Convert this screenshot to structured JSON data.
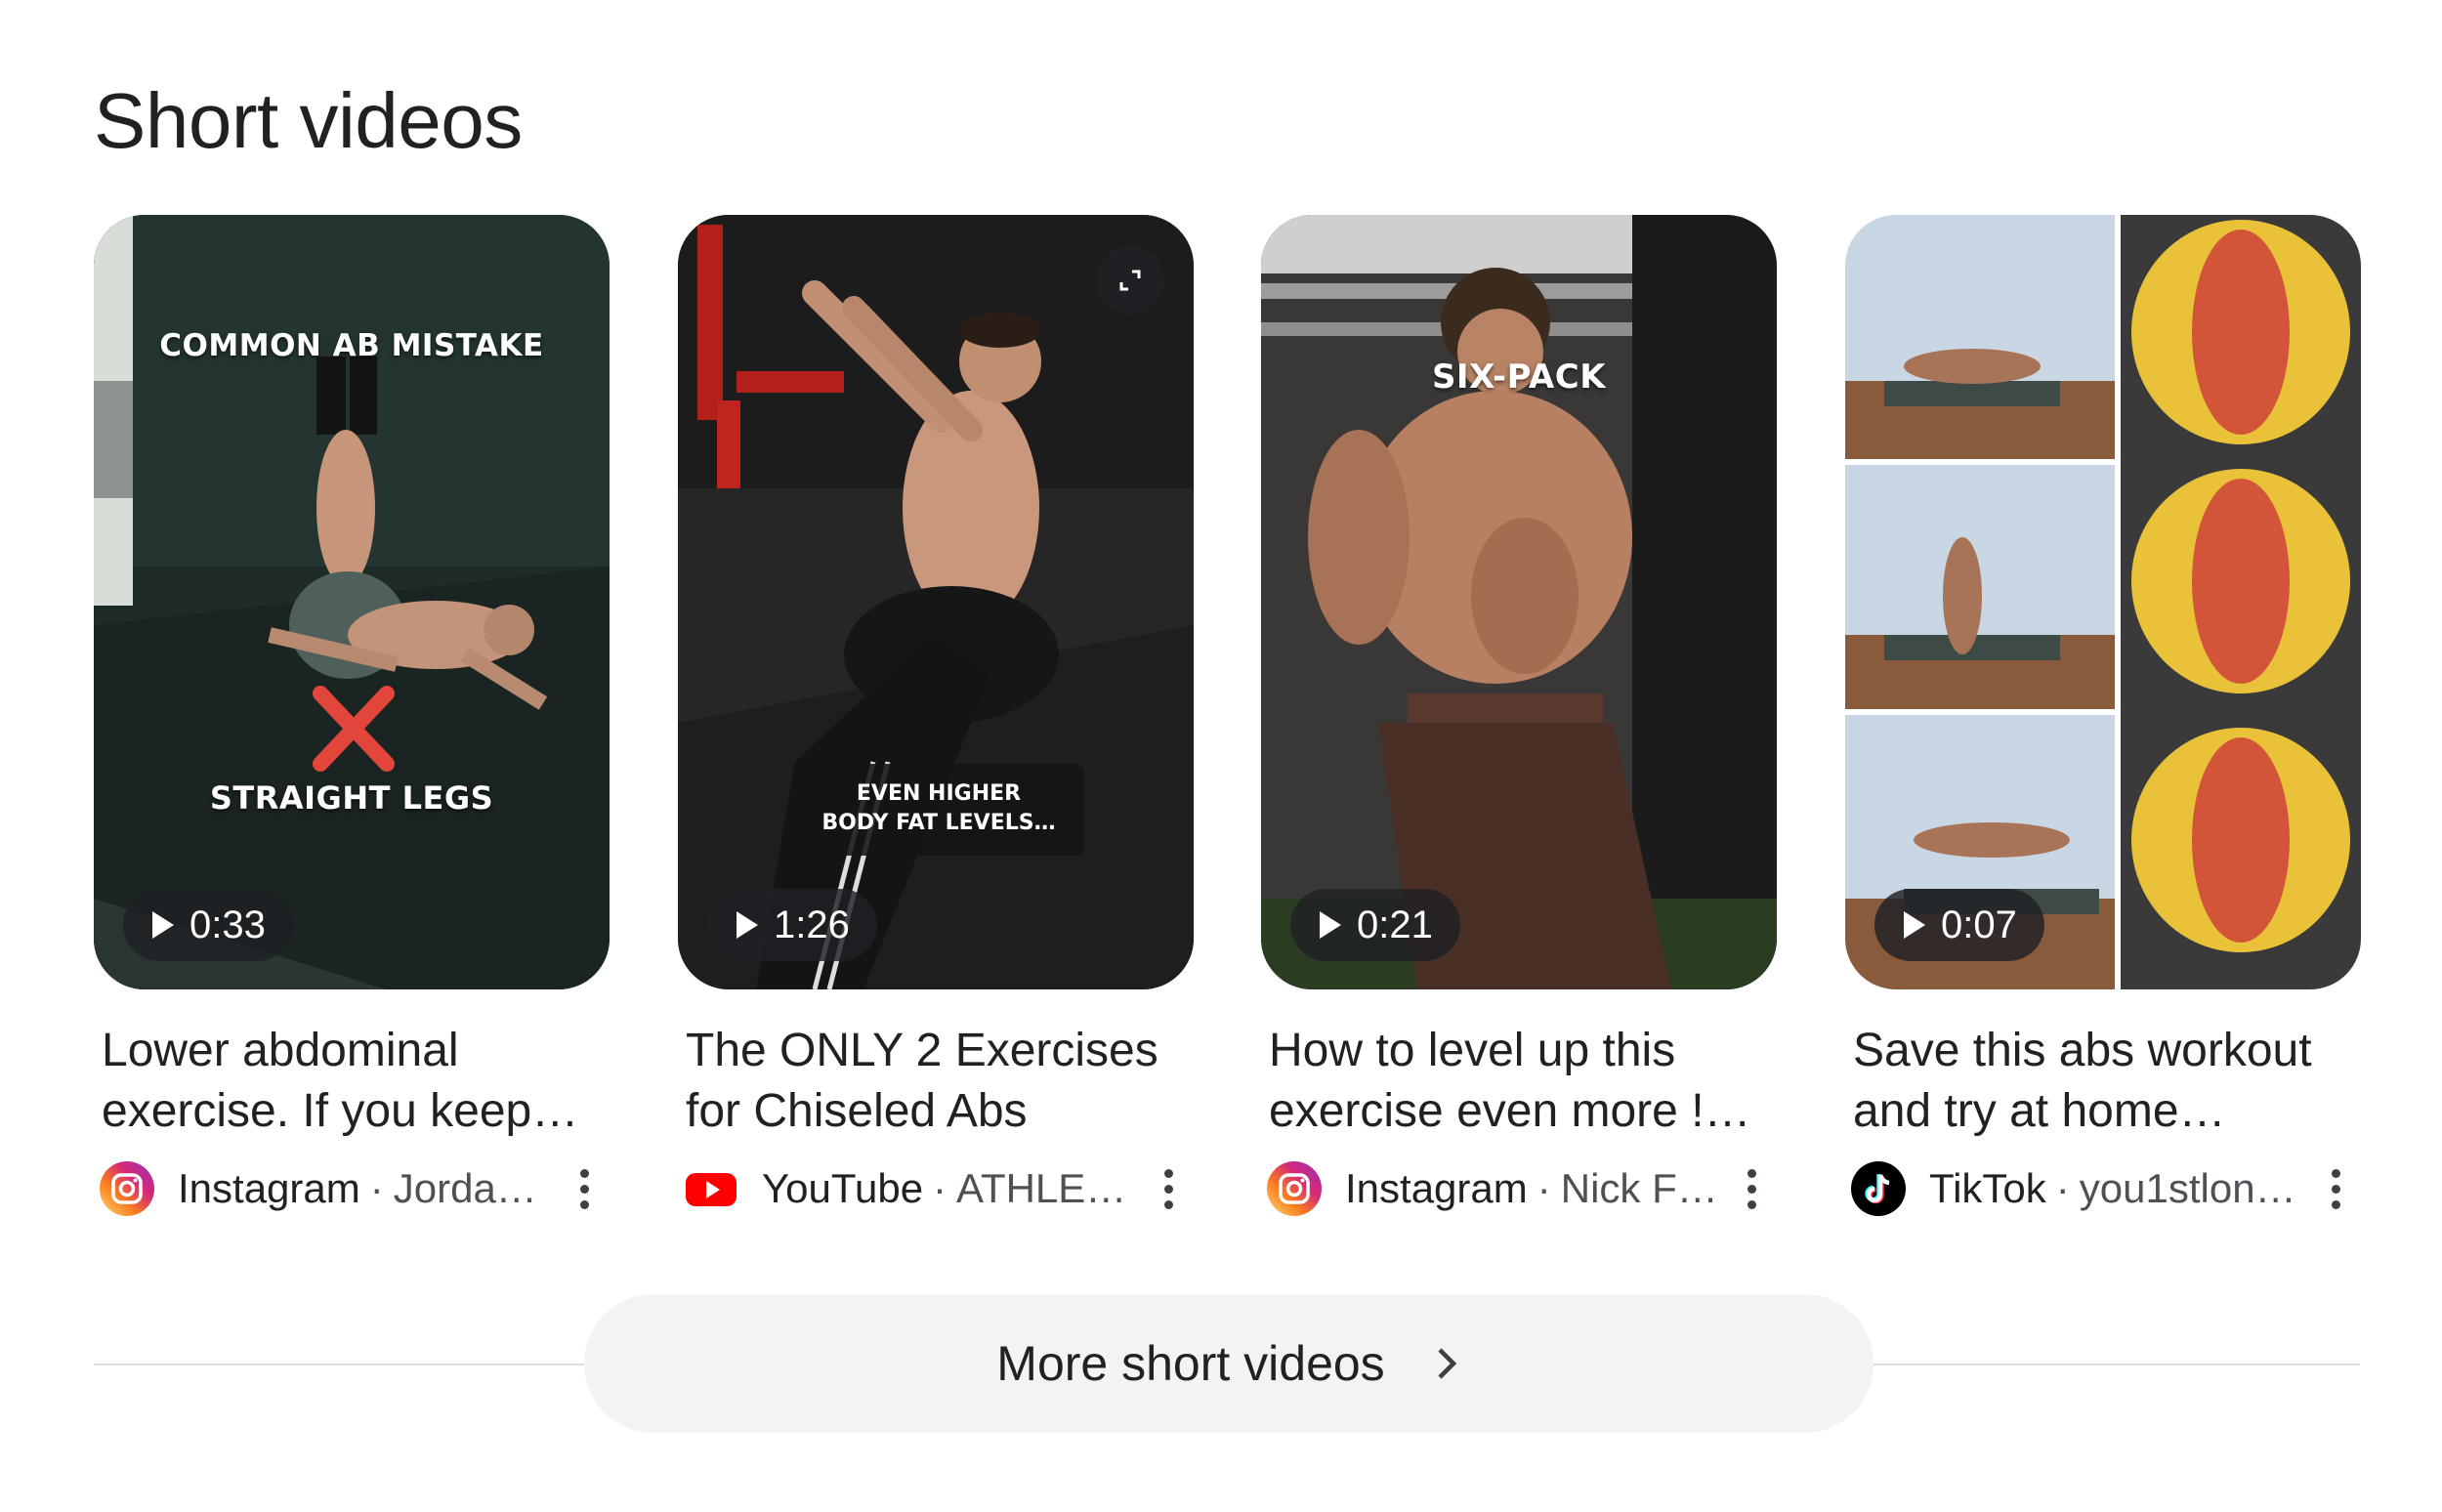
{
  "section_title": "Short videos",
  "cards": [
    {
      "title": "Lower abdominal exercise. If you keep…",
      "source": "Instagram",
      "author": "Jorda…",
      "duration": "0:33",
      "overlay_top": "COMMON AB MISTAKE",
      "overlay_bottom": "STRAIGHT LEGS",
      "icon": "instagram-icon"
    },
    {
      "title": "The ONLY 2 Exercises for Chiseled Abs",
      "source": "YouTube",
      "author": "ATHLE…",
      "duration": "1:26",
      "caption_line1": "EVEN HIGHER",
      "caption_line2": "BODY FAT LEVELS…",
      "icon": "youtube-icon"
    },
    {
      "title": "How to level up this exercise even more !…",
      "source": "Instagram",
      "author": "Nick F…",
      "duration": "0:21",
      "overlay_top": "SIX-PACK",
      "icon": "instagram-icon"
    },
    {
      "title": "Save this abs workout and try at home…",
      "source": "TikTok",
      "author": "you1stlon…",
      "duration": "0:07",
      "icon": "tiktok-icon"
    }
  ],
  "separator": "·",
  "more_button_label": "More short videos",
  "colors": {
    "instagram_gradient": [
      "#feda75",
      "#fa7e1e",
      "#d62976",
      "#962fbf"
    ],
    "youtube_red": "#ff0000",
    "tiktok_black": "#000000",
    "button_bg": "#f1f3f4"
  }
}
